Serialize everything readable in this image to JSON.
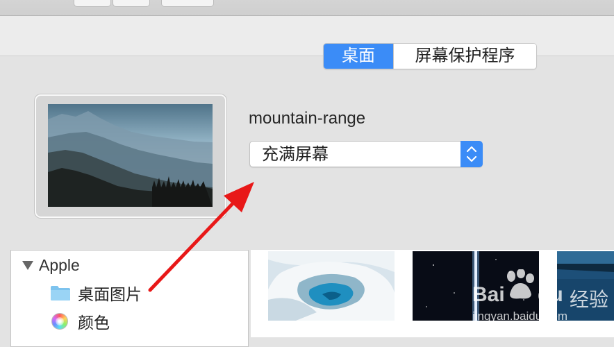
{
  "segmented": {
    "desktop_label": "桌面",
    "screensaver_label": "屏幕保护程序",
    "accent_color": "#3b8cf7"
  },
  "preview": {
    "wallpaper_name": "mountain-range"
  },
  "fit_popup": {
    "selected": "充满屏幕"
  },
  "source_list": {
    "group": "Apple",
    "items": [
      {
        "label": "桌面图片",
        "icon": "folder-icon"
      },
      {
        "label": "颜色",
        "icon": "color-wheel-icon"
      }
    ]
  },
  "annotation": {
    "arrow_color": "#e81818"
  },
  "watermark": {
    "brand_a": "Bai",
    "brand_b": "du",
    "cn": "经验",
    "url": "jingyan.baidu.com"
  }
}
